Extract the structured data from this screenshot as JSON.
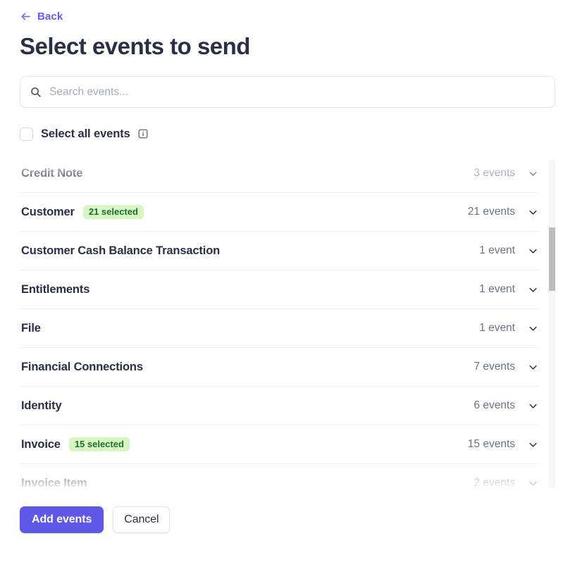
{
  "nav": {
    "back_label": "Back",
    "back_icon": "arrow-left-icon"
  },
  "header": {
    "title": "Select events to send"
  },
  "search": {
    "placeholder": "Search events...",
    "value": "",
    "icon": "search-icon"
  },
  "select_all": {
    "label": "Select all events",
    "checked": false,
    "info_icon": "info-icon"
  },
  "colors": {
    "accent": "#635bff",
    "primary_button": "#5e57e8",
    "badge_bg": "#d7f7c2",
    "badge_text": "#1b6e2d",
    "title_text": "#2a2f45",
    "muted_text": "#697386",
    "divider": "#eceff3",
    "scrollbar_thumb": "#bdbdbd"
  },
  "event_list": {
    "expand_icon": "chevron-down-icon",
    "rows": [
      {
        "name": "Credit Note",
        "count": "3 events",
        "badge": ""
      },
      {
        "name": "Customer",
        "count": "21 events",
        "badge": "21 selected"
      },
      {
        "name": "Customer Cash Balance Transaction",
        "count": "1 event",
        "badge": ""
      },
      {
        "name": "Entitlements",
        "count": "1 event",
        "badge": ""
      },
      {
        "name": "File",
        "count": "1 event",
        "badge": ""
      },
      {
        "name": "Financial Connections",
        "count": "7 events",
        "badge": ""
      },
      {
        "name": "Identity",
        "count": "6 events",
        "badge": ""
      },
      {
        "name": "Invoice",
        "count": "15 events",
        "badge": "15 selected"
      },
      {
        "name": "Invoice Item",
        "count": "2 events",
        "badge": ""
      }
    ]
  },
  "footer": {
    "primary_label": "Add events",
    "secondary_label": "Cancel"
  }
}
